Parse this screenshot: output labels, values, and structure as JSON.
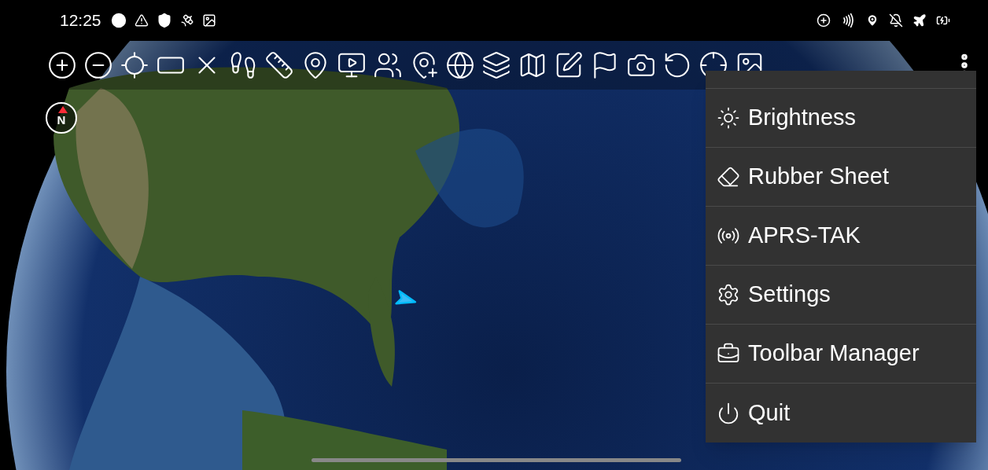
{
  "status_bar": {
    "time": "12:25"
  },
  "compass": {
    "label": "N"
  },
  "menu": {
    "items": [
      {
        "label": "Brightness"
      },
      {
        "label": "Rubber Sheet"
      },
      {
        "label": "APRS-TAK"
      },
      {
        "label": "Settings"
      },
      {
        "label": "Toolbar Manager"
      },
      {
        "label": "Quit"
      }
    ]
  }
}
